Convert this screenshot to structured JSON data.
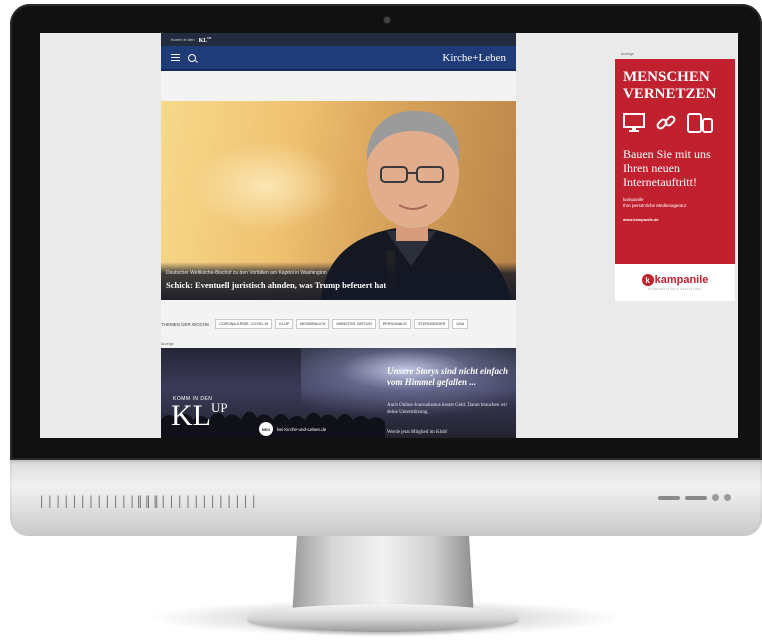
{
  "top_strip": {
    "text": "Komm in den",
    "logo": "KL",
    "logo_sup": "UP"
  },
  "header": {
    "brand": "Kirche+Leben"
  },
  "hero": {
    "subtitle": "Deutscher Weltkirche-Bischof zu den Vorfällen am Kapitol in Washington",
    "title": "Schick: Eventuell juristisch ahnden, was Trump befeuert hat"
  },
  "themes": {
    "label": "THEMEN DER WOCHE",
    "tags": [
      "CORONA-KRISE, COVID-19",
      "KLUP",
      "MISSBRAUCH",
      "MÜNSTER, BISTUM",
      "PERSONALIE",
      "STERNSINGER",
      "USA"
    ]
  },
  "ad_label": "Anzeige",
  "ad_banner": {
    "komm": "KOMM IN DEN",
    "kl": "KL",
    "up": "UP",
    "neu": "NEU",
    "neu_text": "bei Kirche-und-Leben.de",
    "headline": "Unsere Storys sind nicht einfach vom Himmel gefallen ...",
    "text": "Auch Online-Journalismus kostet Geld. Daran brauchen wir deine Unterstützung.",
    "text2": "Werde jetzt Mitglied im Klub!"
  },
  "side_ad": {
    "label": "Anzeige",
    "headline_1": "MENSCHEN",
    "headline_2": "VERNETZEN",
    "body": "Bauen Sie mit uns Ihren neuen Internetauftritt!",
    "company": "kampanile",
    "company_sub": "Ihre persönliche Medienagentur",
    "url": "www.kampanile.de",
    "logo": "kampanile",
    "logo_tag": "KOMMUNIKATION & GESTALTUNG"
  },
  "monitor": {
    "grill_left": "|||||||||||||||",
    "grill_right": "|||||||||||||||"
  },
  "colors": {
    "navy": "#1f3b78",
    "ad_red": "#c1202f"
  }
}
